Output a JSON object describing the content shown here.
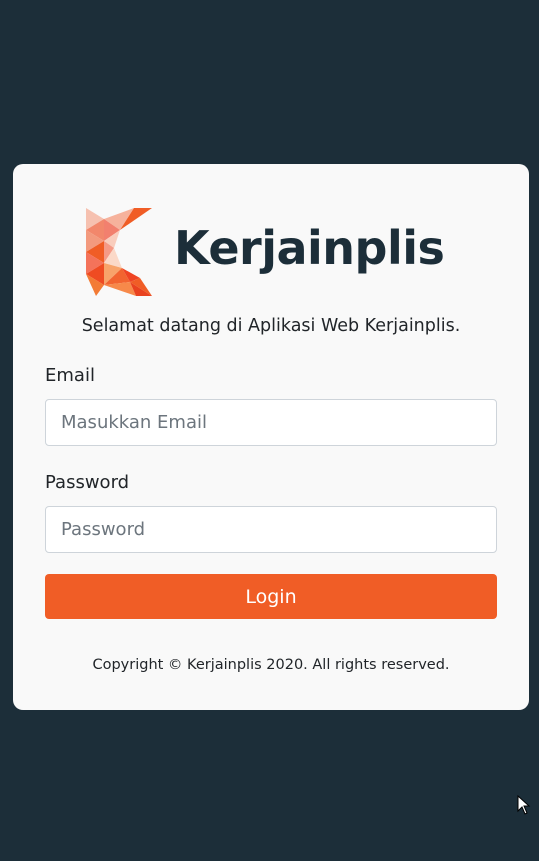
{
  "brand": {
    "name": "Kerjainplis",
    "logo_icon": "kerjainplis-k-logo-icon"
  },
  "login": {
    "welcome": "Selamat datang di Aplikasi Web Kerjainplis.",
    "email_label": "Email",
    "email_placeholder": "Masukkan Email",
    "email_value": "",
    "password_label": "Password",
    "password_placeholder": "Password",
    "password_value": "",
    "submit_label": "Login"
  },
  "footer": {
    "copyright": "Copyright © Kerjainplis 2020. All rights reserved."
  },
  "colors": {
    "background": "#1c2e39",
    "card": "#f9f9f9",
    "accent": "#f05d26",
    "logo_text": "#1c2e39"
  },
  "cursor_icon": "mouse-pointer-icon"
}
